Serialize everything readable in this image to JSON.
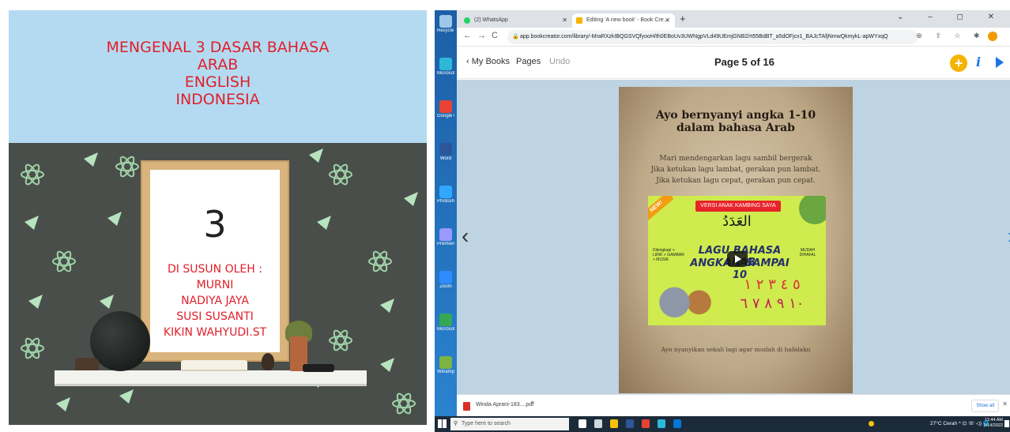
{
  "colors": {
    "cover_title": "#e0202a",
    "cover_sky": "#b4daf1",
    "desktop_bg": "#2273c1",
    "bookcreator_accent": "#f5b400",
    "link_blue": "#1a73e8"
  },
  "cover": {
    "title_lines": [
      "MENGENAL 3 DASAR BAHASA",
      "ARAB",
      "ENGLISH",
      "INDONESIA"
    ],
    "frame_number": "3",
    "credits": [
      "DI SUSUN OLEH :",
      "MURNI",
      "NADIYA JAYA",
      "SUSI SUSANTI",
      "KIKIN WAHYUDI.ST"
    ]
  },
  "desktop_icons": [
    {
      "label": "Recycle Bin",
      "icon": "recycle-bin-icon",
      "color": "#9ec6e8"
    },
    {
      "label": "Microsoft Edge",
      "icon": "edge-icon",
      "color": "#2db8d8"
    },
    {
      "label": "Google Chrome",
      "icon": "chrome-icon",
      "color": "#e94235"
    },
    {
      "label": "Word",
      "icon": "word-icon",
      "color": "#2b579a"
    },
    {
      "label": "Photoshop",
      "icon": "photoshop-icon",
      "color": "#31a8ff"
    },
    {
      "label": "Premiere",
      "icon": "premiere-icon",
      "color": "#9999ff"
    },
    {
      "label": "Zoom",
      "icon": "zoom-icon",
      "color": "#2d8cff"
    },
    {
      "label": "Microsoft Edge",
      "icon": "edge-icon",
      "color": "#34a853"
    },
    {
      "label": "Winamp",
      "icon": "app-icon",
      "color": "#7cb342"
    }
  ],
  "browser": {
    "tabs": [
      {
        "label": "(2) WhatsApp",
        "icon": "whatsapp-icon",
        "color": "#25d366",
        "active": false
      },
      {
        "label": "Editing 'A new book' - Book Cre...",
        "icon": "bookcreator-icon",
        "color": "#f5b400",
        "active": true
      }
    ],
    "new_tab": "+",
    "window_controls": "⌄ – ◻ ✕",
    "url": "app.bookcreator.com/library/-MraRXzkIBQGSVQfyooH/th0EBoUv3UWNgpVLd49UEmjGNB2/rt55BdBT_a5dOFjcx1_BAJcTAfjNmwQkmykL-apWYxqQ",
    "nav": {
      "back": "←",
      "forward": "→",
      "reload": "C"
    },
    "extensions": "⊕ ⇪ ☆ ✱ ⋮"
  },
  "app_bar": {
    "my_books": "My Books",
    "pages": "Pages",
    "undo": "Undo",
    "page_indicator": "Page 5 of 16",
    "add": "+",
    "info": "i"
  },
  "book_page": {
    "title_lines": [
      "Ayo bernyanyi angka 1-10",
      "dalam bahasa Arab"
    ],
    "verses": [
      "Mari mendengarkan lagu sambil bergerak",
      "Jika ketukan lagu lambat, gerakan pun lambat.",
      "Jika ketukan lagu cepat, gerakan pun cepat."
    ],
    "footer": "Ayo nyanyikan sekali lagi agar mudah di hafalakn",
    "video": {
      "ribbon": "NEW!",
      "banner": "VERSI ANAK KAMBING SAYA",
      "arabic_title": "العَدَدُ",
      "line1": "LAGU BAHASA ARAB",
      "line2": "ANGKA 1 SAMPAI 10",
      "side_left": "Dilengkapi + LIRIK + GAMBAR + MUSIK",
      "side_right": "MUDAH DIHAFAL",
      "digits_row1": "٥ ٤ ٣ ٢ ١",
      "digits_row2": "١٠ ٩ ٨ ٧ ٦"
    }
  },
  "downloads": {
    "file_name": "Winda Aprani-183....pdf",
    "chevron": "^",
    "show_all": "Show all",
    "close": "✕"
  },
  "taskbar": {
    "search_placeholder": "Type here to search",
    "apps": [
      {
        "icon": "cortana-icon",
        "color": "#ffffff"
      },
      {
        "icon": "task-view-icon",
        "color": "#cfd8dc"
      },
      {
        "icon": "file-explorer-icon",
        "color": "#f4c20d"
      },
      {
        "icon": "word-icon",
        "color": "#2b579a"
      },
      {
        "icon": "chrome-icon",
        "color": "#e94235"
      },
      {
        "icon": "edge-icon",
        "color": "#2db8d8"
      },
      {
        "icon": "store-icon",
        "color": "#0078d4"
      }
    ],
    "tray": "27°C Cerah ^ ⊡ ☏ ◁) 🌐",
    "time": "11:44 AM",
    "date": "3/14/2022"
  }
}
